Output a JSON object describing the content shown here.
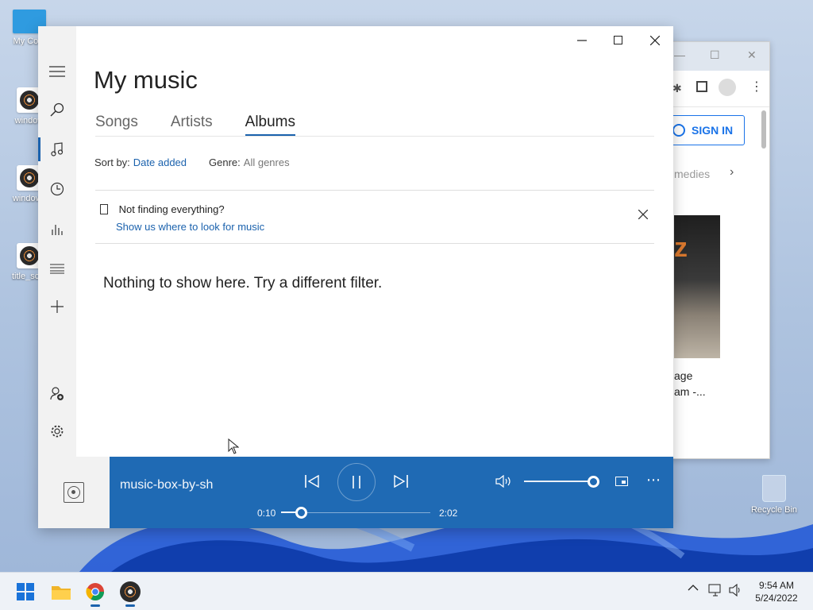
{
  "desktop": {
    "icons": [
      {
        "label": "My Com"
      },
      {
        "label": "window"
      },
      {
        "label": "windows"
      },
      {
        "label": "title_scre"
      }
    ],
    "recycle_bin": "Recycle Bin"
  },
  "browser": {
    "sign_in": "SIGN IN",
    "chip_text": "medies",
    "caption_line1": "age",
    "caption_line2": "am -...",
    "thumb_letter": "z"
  },
  "music_app": {
    "title": "My music",
    "tabs": [
      {
        "label": "Songs",
        "active": false
      },
      {
        "label": "Artists",
        "active": false
      },
      {
        "label": "Albums",
        "active": true
      }
    ],
    "sort_label": "Sort by:",
    "sort_value": "Date added",
    "genre_label": "Genre:",
    "genre_value": "All genres",
    "notice_text": "Not finding everything?",
    "notice_link": "Show us where to look for music",
    "empty_message": "Nothing to show here. Try a different filter.",
    "nav": [
      "hamburger-icon",
      "search-icon",
      "music-note-icon",
      "clock-icon",
      "bars-icon",
      "playlist-icon",
      "plus-icon",
      "add-user-icon",
      "gear-icon"
    ],
    "accent_color": "#1b62ad",
    "player_color": "#1f6ab4"
  },
  "player": {
    "track_title": "music-box-by-sh",
    "elapsed": "0:10",
    "duration": "2:02",
    "progress": 0.08,
    "volume": 0.85
  },
  "taskbar": {
    "time": "9:54 AM",
    "date": "5/24/2022"
  }
}
